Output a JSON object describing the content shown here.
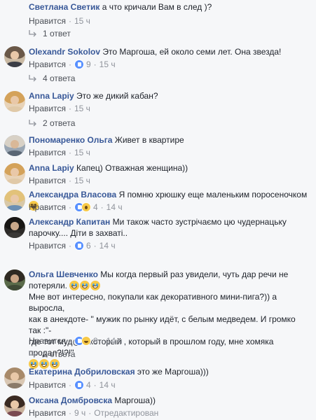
{
  "comments": [
    {
      "name": "Светлана Светик",
      "text": "а что кричали Вам в след )?",
      "like": "Нравится",
      "time": "15 ч",
      "replies": "1 ответ"
    },
    {
      "name": "Olexandr Sokolov",
      "text": "Это Маргоша, ей около семи лет. Она звезда!",
      "like": "Нравится",
      "react_count": "9",
      "time": "15 ч",
      "replies": "4 ответа"
    },
    {
      "name": "Anna Lapiy",
      "text": "Это же дикий кабан?",
      "like": "Нравится",
      "time": "15 ч",
      "replies": "2 ответа"
    },
    {
      "name": "Пономаренко Ольга",
      "text": "Живет в квартире",
      "like": "Нравится",
      "time": "15 ч"
    },
    {
      "name": "Anna Lapiy",
      "text": "Капец) Отважная женщина))",
      "like": "Нравится",
      "time": "15 ч"
    },
    {
      "name": "Александра Власова",
      "text": "Я помню хрюшку еще маленьким поросеночком",
      "like": "Нравится",
      "react_count": "4",
      "time": "14 ч"
    },
    {
      "name": "Александр Капитан",
      "text_line1": "Ми також часто зустрічаємо цю чудернацьку",
      "text_line2": "парочку.... Діти в захваті..",
      "like": "Нравится",
      "react_count": "6",
      "time": "14 ч"
    },
    {
      "name": "Ольга Шевченко",
      "text_line1": "Мы когда первый раз увидели, чуть дар речи не",
      "text_line2": "потеряли.",
      "text_line3": "Мне вот интересно, покупали как декоративного мини-пига?)) а выросла,",
      "text_line4": "как в анекдоте- \" мужик по рынку идёт, с белым медведем. И громко так :\"-",
      "text_line5": "где тот муд@к, который , который в прошлом году, мне хомяка продал?!?!\"",
      "like": "Нравится",
      "react_count": "9",
      "time": "14 ч",
      "replies": "2 ответа"
    },
    {
      "name": "Екатерина Добриловская",
      "text": "это же Маргоша)))",
      "like": "Нравится",
      "react_count": "4",
      "time": "14 ч"
    },
    {
      "name": "Оксана Домбровска",
      "text": "Маргоша))",
      "like": "Нравится",
      "time": "9 ч",
      "edited": "Отредактирован"
    }
  ]
}
